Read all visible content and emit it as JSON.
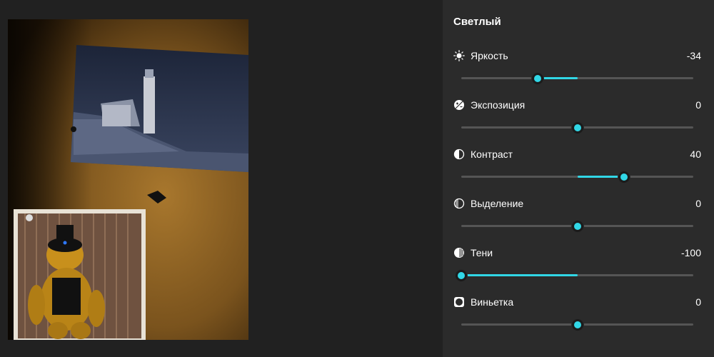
{
  "panel": {
    "title": "Светлый",
    "accent_color": "#31d7e6"
  },
  "adjustments": [
    {
      "id": "brightness",
      "label": "Яркость",
      "value": "-34",
      "level": -34,
      "min": -100,
      "max": 100,
      "icon": "sun-icon"
    },
    {
      "id": "exposure",
      "label": "Экспозиция",
      "value": "0",
      "level": 0,
      "min": -100,
      "max": 100,
      "icon": "exposure-icon"
    },
    {
      "id": "contrast",
      "label": "Контраст",
      "value": "40",
      "level": 40,
      "min": -100,
      "max": 100,
      "icon": "contrast-icon"
    },
    {
      "id": "highlights",
      "label": "Выделение",
      "value": "0",
      "level": 0,
      "min": -100,
      "max": 100,
      "icon": "highlights-icon"
    },
    {
      "id": "shadows",
      "label": "Тени",
      "value": "-100",
      "level": -100,
      "min": -100,
      "max": 100,
      "icon": "shadows-icon"
    },
    {
      "id": "vignette",
      "label": "Виньетка",
      "value": "0",
      "level": 0,
      "min": -100,
      "max": 100,
      "icon": "vignette-icon"
    }
  ],
  "photo": {
    "subject": "corkboard with lighthouse postcard and teddy bear picture"
  }
}
